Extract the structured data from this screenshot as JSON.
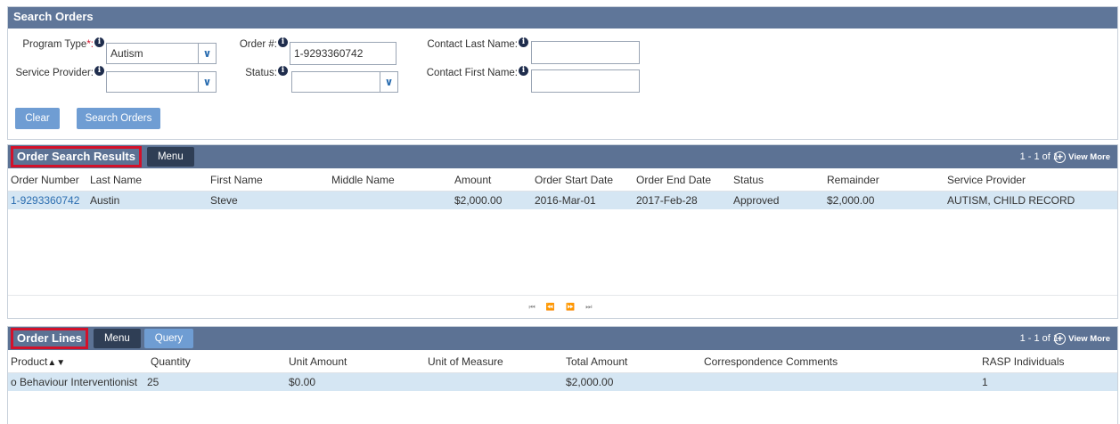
{
  "search": {
    "title": "Search Orders",
    "program_type_label": "Program Type",
    "program_type_req": "*:",
    "program_type_value": "Autism",
    "service_provider_label": "Service Provider:",
    "service_provider_value": "",
    "order_num_label": "Order #:",
    "order_num_value": "1-9293360742",
    "status_label": "Status:",
    "status_value": "",
    "contact_last_label": "Contact Last Name:",
    "contact_last_value": "",
    "contact_first_label": "Contact First Name:",
    "contact_first_value": "",
    "clear_label": "Clear",
    "search_label": "Search Orders",
    "info_glyph": "i",
    "dropdown_glyph": "∨"
  },
  "results": {
    "title": "Order Search Results",
    "menu_label": "Menu",
    "pager": "1 - 1 of 1",
    "view_more": "View More",
    "columns": [
      "Order Number",
      "Last Name",
      "First Name",
      "Middle Name",
      "Amount",
      "Order Start Date",
      "Order End Date",
      "Status",
      "Remainder",
      "Service Provider"
    ],
    "rows": [
      [
        "1-9293360742",
        "Austin",
        "Steve",
        "",
        "$2,000.00",
        "2016-Mar-01",
        "2017-Feb-28",
        "Approved",
        "$2,000.00",
        "AUTISM, CHILD RECORD"
      ]
    ],
    "pager_nav": "⏮ ⏪ ⏩ ⏭"
  },
  "lines": {
    "title": "Order Lines",
    "menu_label": "Menu",
    "query_label": "Query",
    "pager": "1 - 1 of 1",
    "view_more": "View More",
    "sort_glyph": "▲▼",
    "columns": [
      "Product",
      "Quantity",
      "Unit Amount",
      "Unit of Measure",
      "Total Amount",
      "Correspondence Comments",
      "RASP Individuals"
    ],
    "rows": [
      [
        "o  Behaviour Interventionist",
        "25",
        "$0.00",
        "",
        "$2,000.00",
        "",
        "1"
      ]
    ]
  },
  "colors": {
    "header_bg": "#5c7294",
    "accent_blue": "#6f9dd3",
    "highlight_row": "#d5e6f3",
    "annotation_red": "#d3112a",
    "dark_button": "#2f3e55"
  }
}
